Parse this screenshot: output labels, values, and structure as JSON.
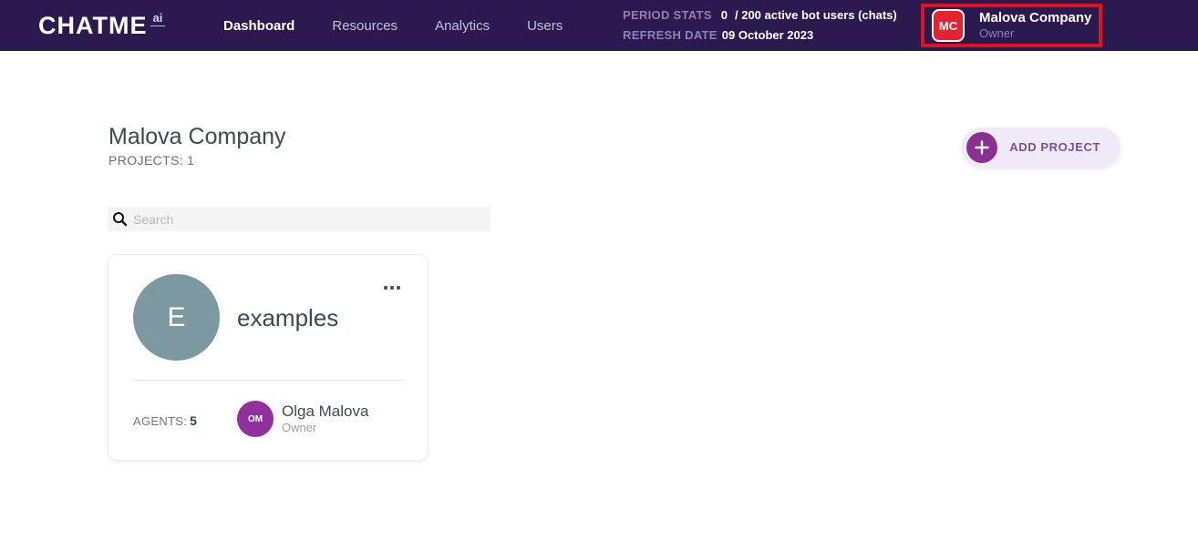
{
  "header": {
    "logo": {
      "brand": "CHATME",
      "suffix": "ai"
    },
    "nav": [
      {
        "label": "Dashboard",
        "active": true
      },
      {
        "label": "Resources",
        "active": false
      },
      {
        "label": "Analytics",
        "active": false
      },
      {
        "label": "Users",
        "active": false
      }
    ],
    "stats": {
      "period_label": "PERIOD STATS",
      "period_value": "0",
      "period_suffix": "/ 200 active bot users (chats)",
      "refresh_label": "REFRESH DATE",
      "refresh_value": "09 October 2023"
    },
    "account": {
      "initials": "MC",
      "name": "Malova Company",
      "role": "Owner"
    }
  },
  "main": {
    "title": "Malova Company",
    "projects_label": "PROJECTS:",
    "projects_count": "1",
    "add_project_label": "ADD PROJECT",
    "search_placeholder": "Search"
  },
  "project_card": {
    "initial": "E",
    "name": "examples",
    "agents_label": "AGENTS:",
    "agents_count": "5",
    "owner": {
      "initials": "OM",
      "name": "Olga Malova",
      "role": "Owner"
    }
  },
  "icons": {
    "search": "magnifier-icon",
    "add": "plus-icon",
    "more": "more-horizontal-icon"
  },
  "colors": {
    "header_bg": "#2a1a50",
    "header_muted_text": "#8d83ae",
    "nav_inactive": "#c7c0dc",
    "annotation_red": "#e0121e",
    "account_avatar_red": "#e52330",
    "add_button_bg": "#efeaf8",
    "add_button_purple": "#8a3093",
    "add_button_text": "#7b4f9b",
    "project_avatar_teal": "#7c99a2",
    "owner_avatar_purple": "#90309c",
    "title_text": "#3c4a54",
    "search_bg": "#f4f4f4"
  }
}
